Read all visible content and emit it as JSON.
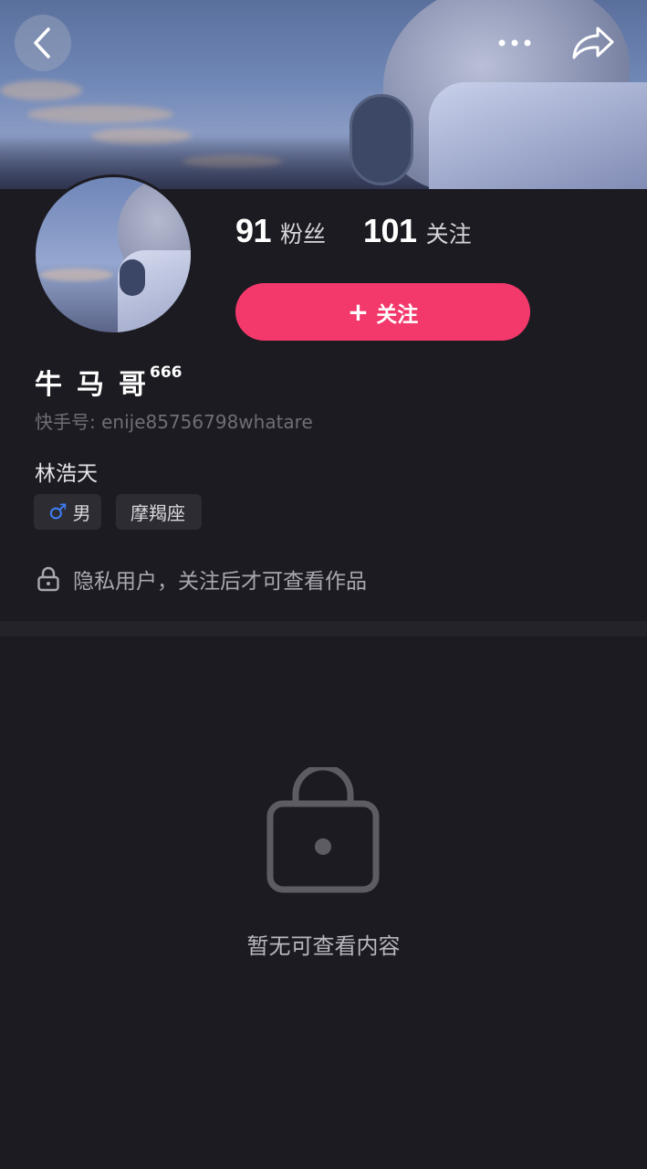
{
  "header": {
    "back_icon": "chevron-left-icon",
    "more_icon": "more-dots-icon",
    "share_icon": "share-arrow-icon"
  },
  "profile": {
    "fans_count": "91",
    "fans_label": "粉丝",
    "following_count": "101",
    "following_label": "关注",
    "follow_button_plus": "+",
    "follow_button_label": "关注",
    "nickname": "牛马哥",
    "nickname_superscript": "666",
    "user_id": "快手号: enije85756798whatare",
    "bio": "林浩天",
    "tags": {
      "gender_symbol": "♂",
      "gender": "男",
      "zodiac": "摩羯座"
    },
    "privacy_notice": "隐私用户，关注后才可查看作品"
  },
  "content": {
    "empty_text": "暂无可查看内容"
  },
  "colors": {
    "background": "#1c1b21",
    "follow_button": "#f3386b",
    "gender_icon": "#3f7ef7"
  }
}
